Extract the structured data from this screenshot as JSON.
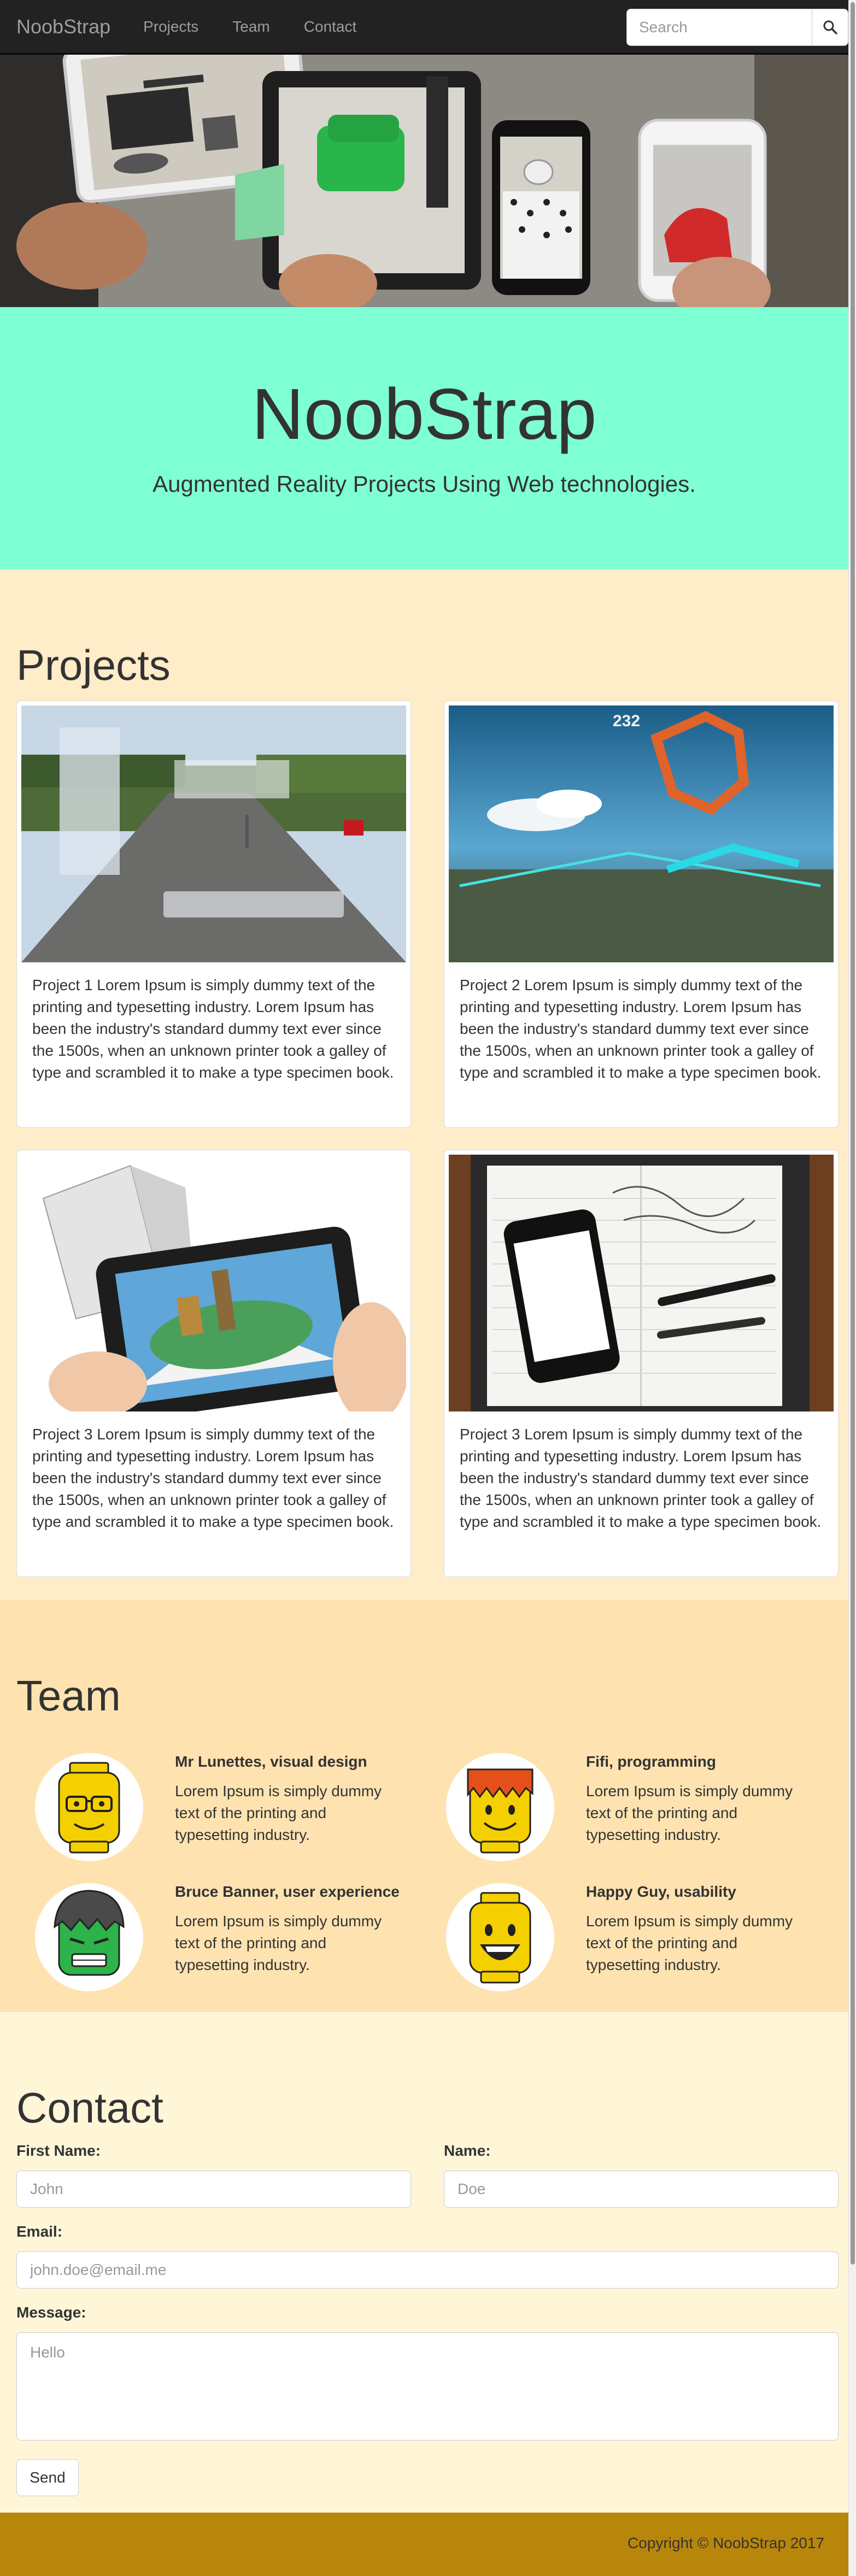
{
  "navbar": {
    "brand": "NoobStrap",
    "links": [
      "Projects",
      "Team",
      "Contact"
    ],
    "search_placeholder": "Search",
    "search_icon": "magnifier-icon"
  },
  "jumbotron": {
    "title": "NoobStrap",
    "subtitle": "Augmented Reality Projects Using Web technologies."
  },
  "projects": {
    "title": "Projects",
    "cards": [
      {
        "text": "Project 1 Lorem Ipsum is simply dummy text of the printing and typesetting industry. Lorem Ipsum has been the industry's standard dummy text ever since the 1500s, when an unknown printer took a galley of type and scrambled it to make a type specimen book."
      },
      {
        "text": "Project 2 Lorem Ipsum is simply dummy text of the printing and typesetting industry. Lorem Ipsum has been the industry's standard dummy text ever since the 1500s, when an unknown printer took a galley of type and scrambled it to make a type specimen book."
      },
      {
        "text": "Project 3 Lorem Ipsum is simply dummy text of the printing and typesetting industry. Lorem Ipsum has been the industry's standard dummy text ever since the 1500s, when an unknown printer took a galley of type and scrambled it to make a type specimen book."
      },
      {
        "text": "Project 3 Lorem Ipsum is simply dummy text of the printing and typesetting industry. Lorem Ipsum has been the industry's standard dummy text ever since the 1500s, when an unknown printer took a galley of type and scrambled it to make a type specimen book."
      }
    ],
    "image_2_score_label": "232"
  },
  "team": {
    "title": "Team",
    "members": [
      {
        "name": "Mr Lunettes, visual design",
        "desc": "Lorem Ipsum is simply dummy text of the printing and typesetting industry."
      },
      {
        "name": "Fifi, programming",
        "desc": "Lorem Ipsum is simply dummy text of the printing and typesetting industry."
      },
      {
        "name": "Bruce Banner, user experience",
        "desc": "Lorem Ipsum is simply dummy text of the printing and typesetting industry."
      },
      {
        "name": "Happy Guy, usability",
        "desc": "Lorem Ipsum is simply dummy text of the printing and typesetting industry."
      }
    ]
  },
  "contact": {
    "title": "Contact",
    "first_name_label": "First Name:",
    "first_name_placeholder": "John",
    "name_label": "Name:",
    "name_placeholder": "Doe",
    "email_label": "Email:",
    "email_placeholder": "john.doe@email.me",
    "message_label": "Message:",
    "message_placeholder": "Hello",
    "send_label": "Send"
  },
  "footer": {
    "copyright": "Copyright © NoobStrap 2017"
  },
  "colors": {
    "navbar": "#222222",
    "jumbotron": "#7fffd4",
    "projects_bg": "#ffecc8",
    "team_bg": "#fee3b0",
    "contact_bg": "#fff6d8",
    "footer": "#b8860b"
  }
}
